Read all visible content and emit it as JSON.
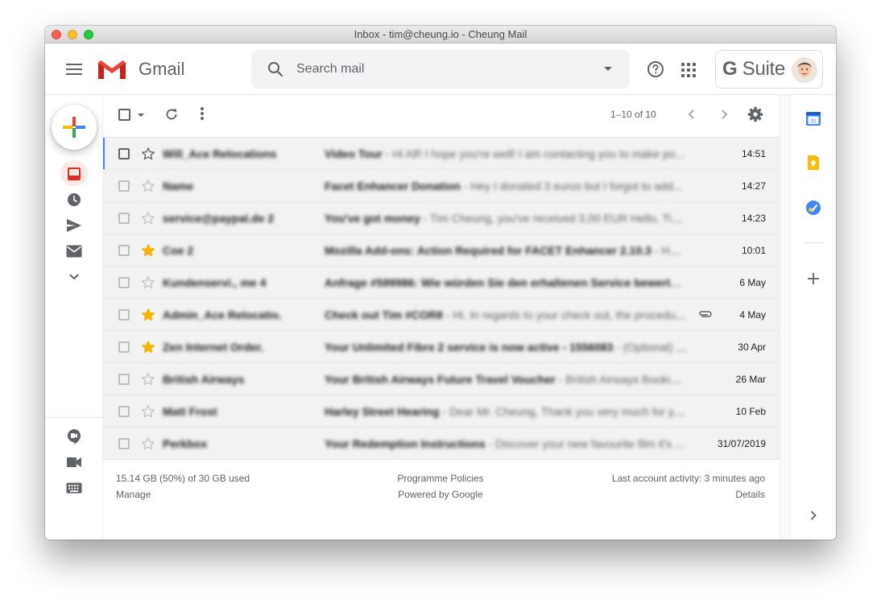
{
  "window": {
    "title": "Inbox - tim@cheung.io - Cheung Mail"
  },
  "header": {
    "logo_text": "Gmail",
    "search_placeholder": "Search mail",
    "gsuite_label": "Suite"
  },
  "toolbar": {
    "pagination": "1–10 of 10"
  },
  "colors": {
    "accent": "#4285f4",
    "star": "#f4b400",
    "inbox_red": "#d93025",
    "row_bg": "#f2f2f2"
  },
  "emails": [
    {
      "sender": "Will_Ace Relocations",
      "subject": "Video Tour",
      "snippet": " - Hi Alf! I hope you're well! I am contacting you to make po...",
      "date": "14:51",
      "starred": false,
      "attachment": false
    },
    {
      "sender": "Name",
      "subject": "Facet Enhancer Donation",
      "snippet": " - Hey I donated 3 euros but I forgot to add...",
      "date": "14:27",
      "starred": false,
      "attachment": false
    },
    {
      "sender": "service@paypal.de 2",
      "subject": "You've got money",
      "snippet": " - Tim Cheung, you've received 3,00 EUR Hello, Tim...",
      "date": "14:23",
      "starred": false,
      "attachment": false
    },
    {
      "sender": "Coe 2",
      "subject": "Mozilla Add-ons: Action Required for FACET Enhancer 2.10.3",
      "snippet": " - Hello...",
      "date": "10:01",
      "starred": true,
      "attachment": false
    },
    {
      "sender": "Kundenservi., me 4",
      "subject": "Anfrage #599986: Wie würden Sie den erhaltenen Service bewerten?",
      "snippet": " - ...",
      "date": "6 May",
      "starred": false,
      "attachment": false
    },
    {
      "sender": "Admin_Ace Relocatio.",
      "subject": "Check out Tim #COR8",
      "snippet": " - Hi, In regards to your check out, the procedur...",
      "date": "4 May",
      "starred": true,
      "attachment": true
    },
    {
      "sender": "Zen Internet Order.",
      "subject": "Your Unlimited Fibre 2 service is now active - 1556083",
      "snippet": " - (Optional) Th...",
      "date": "30 Apr",
      "starred": true,
      "attachment": false
    },
    {
      "sender": "British Airways",
      "subject": "Your British Airways Future Travel Voucher",
      "snippet": " - British Airways Booking ...",
      "date": "26 Mar",
      "starred": false,
      "attachment": false
    },
    {
      "sender": "Matt Frost",
      "subject": "Harley Street Hearing",
      "snippet": " - Dear Mr. Cheung, Thank you very much for yo...",
      "date": "10 Feb",
      "starred": false,
      "attachment": false
    },
    {
      "sender": "Perkbox",
      "subject": "Your Redemption Instructions",
      "snippet": " - Discover your new favourite film it's ...",
      "date": "31/07/2019",
      "starred": false,
      "attachment": false
    }
  ],
  "footer": {
    "storage": "15.14 GB (50%) of 30 GB used",
    "manage": "Manage",
    "policies": "Programme Policies",
    "powered": "Powered by Google",
    "activity": "Last account activity: 3 minutes ago",
    "details": "Details"
  },
  "icons": {
    "left_rail": [
      "compose-icon",
      "inbox-icon",
      "snoozed-icon",
      "sent-icon",
      "all-mail-icon",
      "more-chevron-icon",
      "hangouts-icon",
      "video-icon",
      "keyboard-icon"
    ],
    "right_panel": [
      "calendar-icon",
      "keep-icon",
      "tasks-icon",
      "add-addon-icon",
      "expand-panel-icon"
    ]
  }
}
